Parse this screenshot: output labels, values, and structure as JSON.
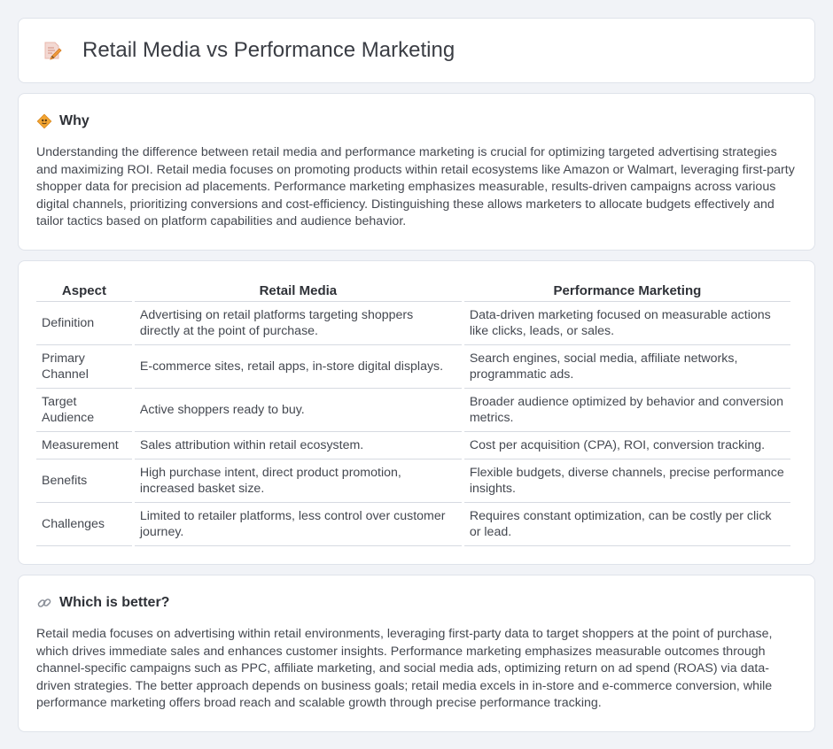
{
  "header": {
    "title": "Retail Media vs Performance Marketing",
    "icon": "document-pencil-icon"
  },
  "why": {
    "icon": "diamond-sign-icon",
    "title": "Why",
    "text": "Understanding the difference between retail media and performance marketing is crucial for optimizing targeted advertising strategies and maximizing ROI. Retail media focuses on promoting products within retail ecosystems like Amazon or Walmart, leveraging first-party shopper data for precision ad placements. Performance marketing emphasizes measurable, results-driven campaigns across various digital channels, prioritizing conversions and cost-efficiency. Distinguishing these allows marketers to allocate budgets effectively and tailor tactics based on platform capabilities and audience behavior."
  },
  "table": {
    "headers": [
      "Aspect",
      "Retail Media",
      "Performance Marketing"
    ],
    "rows": [
      [
        "Definition",
        "Advertising on retail platforms targeting shoppers directly at the point of purchase.",
        "Data-driven marketing focused on measurable actions like clicks, leads, or sales."
      ],
      [
        "Primary Channel",
        "E-commerce sites, retail apps, in-store digital displays.",
        "Search engines, social media, affiliate networks, programmatic ads."
      ],
      [
        "Target Audience",
        "Active shoppers ready to buy.",
        "Broader audience optimized by behavior and conversion metrics."
      ],
      [
        "Measurement",
        "Sales attribution within retail ecosystem.",
        "Cost per acquisition (CPA), ROI, conversion tracking."
      ],
      [
        "Benefits",
        "High purchase intent, direct product promotion, increased basket size.",
        "Flexible budgets, diverse channels, precise performance insights."
      ],
      [
        "Challenges",
        "Limited to retailer platforms, less control over customer journey.",
        "Requires constant optimization, can be costly per click or lead."
      ]
    ]
  },
  "better": {
    "icon": "link-icon",
    "title": "Which is better?",
    "text": "Retail media focuses on advertising within retail environments, leveraging first-party data to target shoppers at the point of purchase, which drives immediate sales and enhances customer insights. Performance marketing emphasizes measurable outcomes through channel-specific campaigns such as PPC, affiliate marketing, and social media ads, optimizing return on ad spend (ROAS) via data-driven strategies. The better approach depends on business goals; retail media excels in in-store and e-commerce conversion, while performance marketing offers broad reach and scalable growth through precise performance tracking."
  },
  "colors": {
    "background": "#f1f3f7",
    "card": "#ffffff",
    "border": "#dfe3ea",
    "icon_accent": "#f0a030"
  }
}
